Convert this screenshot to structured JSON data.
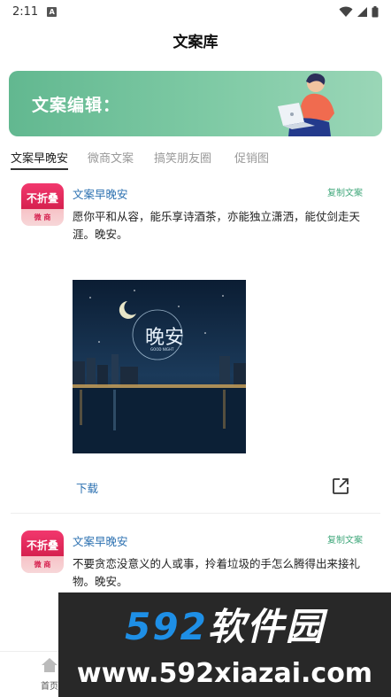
{
  "status": {
    "time": "2:11",
    "a_badge": "A"
  },
  "header": {
    "title": "文案库"
  },
  "banner": {
    "text": "文案编辑："
  },
  "tabs": [
    {
      "label": "文案早晚安",
      "active": true
    },
    {
      "label": "微商文案",
      "active": false
    },
    {
      "label": "搞笑朋友圈",
      "active": false
    },
    {
      "label": "促销图",
      "active": false
    }
  ],
  "posts": [
    {
      "avatar_top": "不折叠",
      "avatar_bottom": "微 商",
      "author": "文案早晚安",
      "copy_label": "复制文案",
      "text": "愿你平和从容，能乐享诗酒茶，亦能独立潇洒，能仗剑走天涯。晚安。",
      "image_caption": "晚安",
      "image_subcaption": "GOOD NIGHT",
      "download_label": "下载"
    },
    {
      "avatar_top": "不折叠",
      "avatar_bottom": "微 商",
      "author": "文案早晚安",
      "copy_label": "复制文案",
      "text": "不要贪恋没意义的人或事，拎着垃圾的手怎么腾得出来接礼物。晚安。"
    }
  ],
  "bottom_nav": {
    "home_label": "首页"
  },
  "watermark": {
    "logo_digits": "592",
    "logo_text": "软件园",
    "url": "www.592xiazai.com"
  },
  "colors": {
    "accent_green": "#43a97d",
    "link_blue": "#2a6fb0",
    "banner_green": "#6cbf98"
  }
}
